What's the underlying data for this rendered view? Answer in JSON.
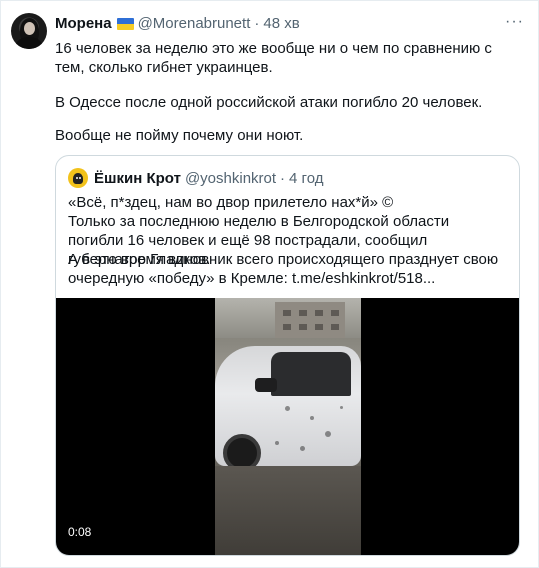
{
  "tweet": {
    "author_name": "Морена",
    "flag_icon": "ukraine-flag",
    "handle": "@Morenabrunett",
    "separator": "·",
    "time": "48 хв",
    "more_icon": "more-horizontal-icon",
    "paragraphs": [
      "16 человек за неделю это же вообще ни о чем по сравнению с тем, сколько гибнет украинцев.",
      "В Одессе после одной российской атаки погибло 20 человек.",
      "Вообще не пойму почему они ноют."
    ]
  },
  "quoted": {
    "author_name": "Ёшкин Крот",
    "handle": "@yoshkinkrot",
    "separator": "·",
    "time": "4 год",
    "paragraphs": [
      "«Всё, п*здец, нам во двор прилетело нах*й» ©",
      "Только за последнюю неделю в Белгородской области погибли 16 человек и ещё 98 пострадали, сообщил губернатор Гладков.",
      "А в это время виновник всего происходящего празднует свою очередную «победу» в Кремле: t.me/eshkinkrot/518..."
    ],
    "video": {
      "duration": "0:08"
    }
  },
  "colors": {
    "text": "#0f1419",
    "secondary": "#536471",
    "border": "#cfd9de",
    "flag_blue": "#2f6fd6",
    "flag_yellow": "#f6cc26"
  }
}
